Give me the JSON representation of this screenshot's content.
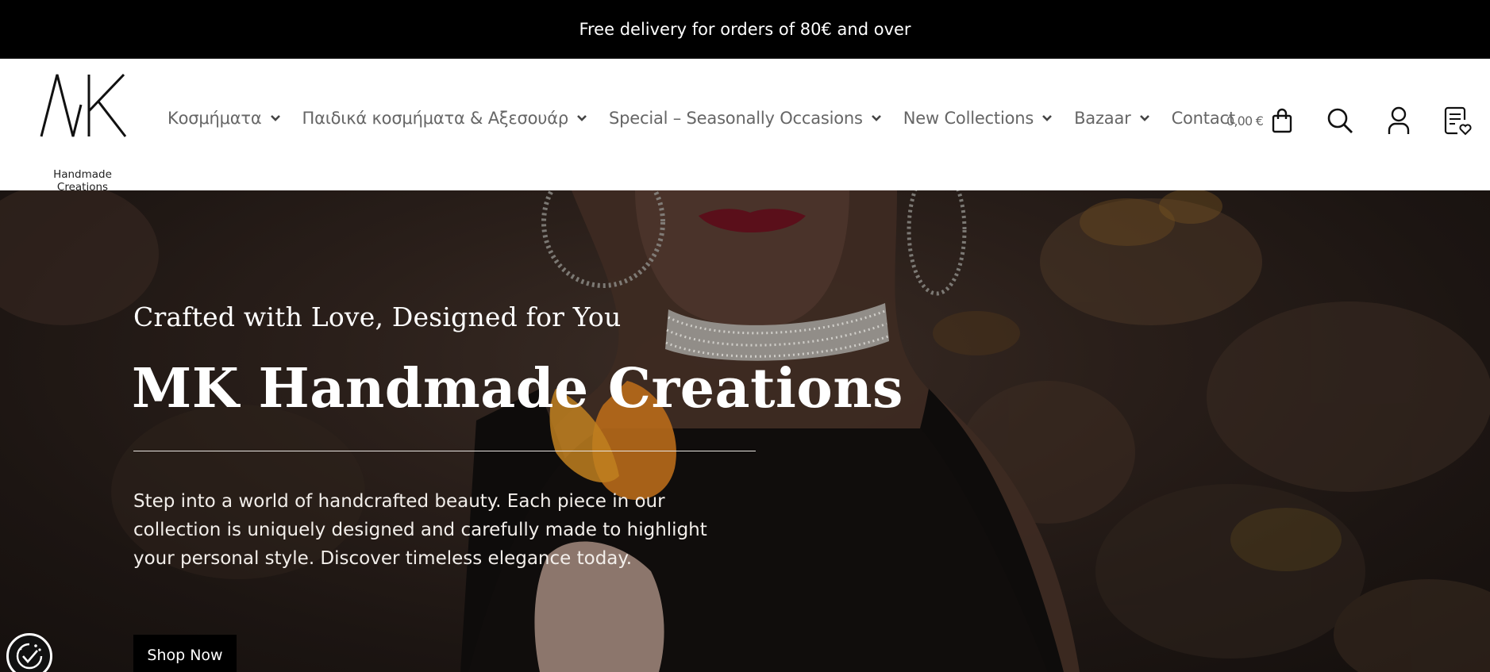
{
  "announcement": "Free delivery for orders of 80€ and over",
  "logo": {
    "mark": "MK",
    "subtitle": "Handmade Creations"
  },
  "nav": [
    {
      "label": "Κοσμήματα",
      "dropdown": true
    },
    {
      "label": "Παιδικά κοσμήματα & Αξεσουάρ",
      "dropdown": true
    },
    {
      "label": "Special – Seasonally Occasions",
      "dropdown": true
    },
    {
      "label": "New Collections",
      "dropdown": true
    },
    {
      "label": "Bazaar",
      "dropdown": true
    },
    {
      "label": "Contact",
      "dropdown": false
    }
  ],
  "header_icons": {
    "cart_total": "0,00 €",
    "cart_icon": "shopping-bag-icon",
    "search_icon": "search-icon",
    "account_icon": "user-icon",
    "wishlist_icon": "wishlist-icon"
  },
  "hero": {
    "subtitle": "Crafted with Love, Designed for You",
    "title": "MK Handmade Creations",
    "text": "Step into a world of handcrafted beauty. Each piece in our collection is uniquely designed and carefully made to highlight your personal style. Discover timeless elegance today.",
    "cta": "Shop Now"
  },
  "cookie_icon": "cookie-consent-icon",
  "colors": {
    "topbar": "#000000",
    "nav_text": "#666666",
    "hero_text": "#ffffff",
    "button_bg": "#000000"
  }
}
